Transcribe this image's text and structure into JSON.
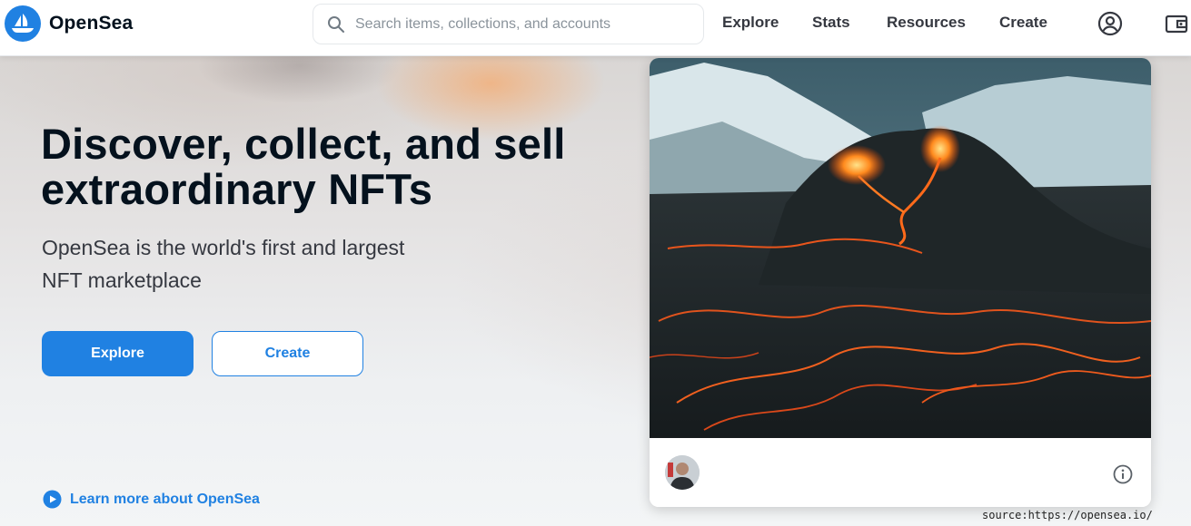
{
  "brand": {
    "name": "OpenSea",
    "logo_icon": "opensea-boat-logo"
  },
  "search": {
    "placeholder": "Search items, collections, and accounts",
    "value": "",
    "icon": "search-icon"
  },
  "nav": {
    "links": [
      "Explore",
      "Stats",
      "Resources",
      "Create"
    ],
    "profile_icon": "account-circle-icon",
    "wallet_icon": "wallet-icon"
  },
  "hero": {
    "headline": "Discover, collect, and sell extraordinary NFTs",
    "subheadline": "OpenSea is the world's first and largest NFT marketplace",
    "buttons": {
      "explore": "Explore",
      "create": "Create"
    },
    "learn_more": "Learn more about OpenSea",
    "learn_more_icon": "play-circle-icon"
  },
  "featured_card": {
    "image": "volcano-eruption-artwork",
    "info_icon": "info-icon"
  },
  "source_note": "source:https://opensea.io/",
  "colors": {
    "brand_blue": "#2081e2",
    "text_dark": "#04111d",
    "text_muted": "#8a939b"
  }
}
